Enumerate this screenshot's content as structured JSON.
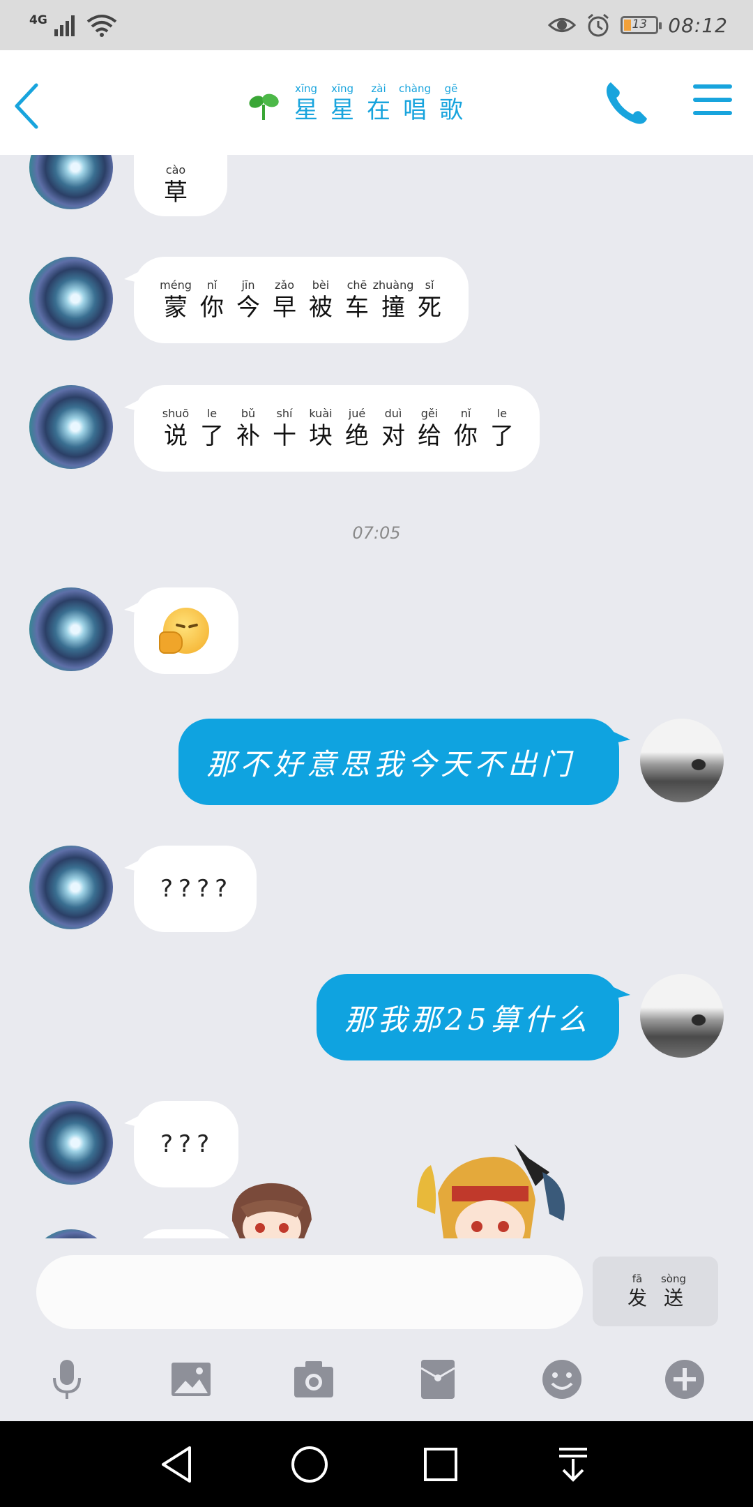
{
  "status_bar": {
    "network": "4G",
    "battery": "13",
    "time": "08:12"
  },
  "header": {
    "title_chars": [
      {
        "py": "xīng",
        "hz": "星"
      },
      {
        "py": "xīng",
        "hz": "星"
      },
      {
        "py": "zài",
        "hz": "在"
      },
      {
        "py": "chàng",
        "hz": "唱"
      },
      {
        "py": "gē",
        "hz": "歌"
      }
    ]
  },
  "messages": {
    "m0": [
      {
        "py": "cào",
        "hz": "草"
      }
    ],
    "m1": [
      {
        "py": "méng",
        "hz": "蒙"
      },
      {
        "py": "nǐ",
        "hz": "你"
      },
      {
        "py": "jīn",
        "hz": "今"
      },
      {
        "py": "zǎo",
        "hz": "早"
      },
      {
        "py": "bèi",
        "hz": "被"
      },
      {
        "py": "chē",
        "hz": "车"
      },
      {
        "py": "zhuàng",
        "hz": "撞"
      },
      {
        "py": "sǐ",
        "hz": "死"
      }
    ],
    "m2": [
      {
        "py": "shuō",
        "hz": "说"
      },
      {
        "py": "le",
        "hz": "了"
      },
      {
        "py": "bǔ",
        "hz": "补"
      },
      {
        "py": "shí",
        "hz": "十"
      },
      {
        "py": "kuài",
        "hz": "块"
      },
      {
        "py": "jué",
        "hz": "绝"
      },
      {
        "py": "duì",
        "hz": "对"
      },
      {
        "py": "gěi",
        "hz": "给"
      },
      {
        "py": "nǐ",
        "hz": "你"
      },
      {
        "py": "le",
        "hz": "了"
      }
    ],
    "timestamp": "07:05",
    "m4_text": "那不好意思我今天不出门",
    "m5_text": "????",
    "m6_text": "那我那25算什么",
    "m7_text": "???"
  },
  "input": {
    "placeholder": "",
    "value": ""
  },
  "send_button": [
    {
      "py": "fā",
      "hz": "发"
    },
    {
      "py": "sòng",
      "hz": "送"
    }
  ],
  "colors": {
    "accent": "#18a4dd",
    "outgoing_bubble": "#0fa3e0",
    "incoming_bubble": "#ffffff",
    "background": "#e9eaef"
  },
  "icons": {
    "toolbar": [
      "microphone-icon",
      "image-icon",
      "camera-icon",
      "red-packet-icon",
      "emoji-icon",
      "plus-icon"
    ],
    "nav": [
      "back-triangle-icon",
      "home-circle-icon",
      "recents-square-icon",
      "notification-pull-icon"
    ]
  }
}
